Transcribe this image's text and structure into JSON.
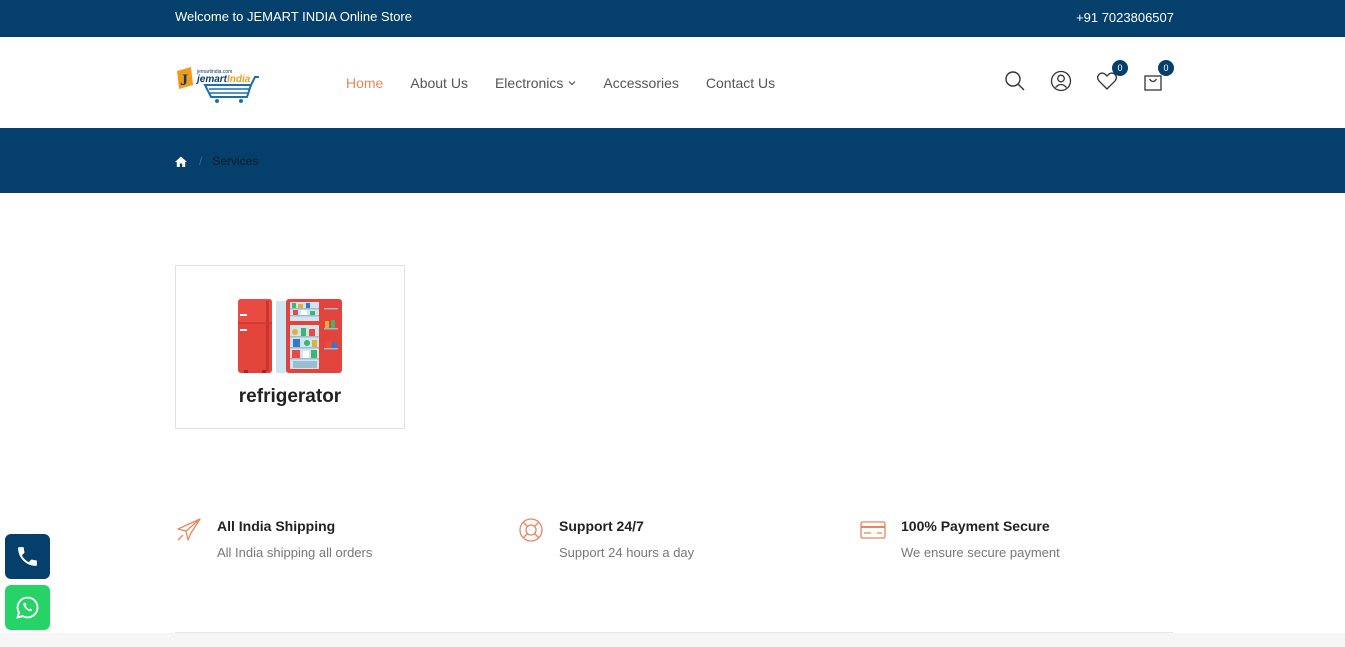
{
  "topbar": {
    "welcome": "Welcome to JEMART INDIA Online Store",
    "phone": "+91 7023806507"
  },
  "header": {
    "logo_alt": "jemartindia",
    "nav": [
      {
        "label": "Home",
        "active": true
      },
      {
        "label": "About Us",
        "active": false
      },
      {
        "label": "Electronics",
        "active": false,
        "dropdown": true
      },
      {
        "label": "Accessories",
        "active": false
      },
      {
        "label": "Contact Us",
        "active": false
      }
    ],
    "icons": [
      "search-icon",
      "user-icon",
      "heart-icon",
      "cart-icon"
    ],
    "wishlist_count": "0",
    "cart_count": "0"
  },
  "breadcrumb": {
    "home_icon": "home-icon",
    "current": "Services"
  },
  "services": [
    {
      "label": "refrigerator",
      "image": "refrigerator-illustration"
    }
  ],
  "features": [
    {
      "icon": "airplane-icon",
      "title": "All India Shipping",
      "desc": "All India shipping all orders"
    },
    {
      "icon": "lifebuoy-icon",
      "title": "Support 24/7",
      "desc": "Support 24 hours a day"
    },
    {
      "icon": "credit-card-icon",
      "title": "100% Payment Secure",
      "desc": "We ensure secure payment"
    }
  ],
  "floating": {
    "call_icon": "phone-icon",
    "whatsapp_icon": "whatsapp-icon"
  },
  "colors": {
    "primary": "#053f6b",
    "accent": "#e8865d",
    "whatsapp": "#25d366"
  }
}
